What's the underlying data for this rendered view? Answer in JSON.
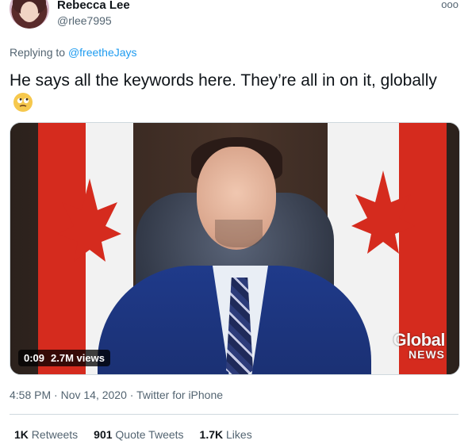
{
  "user": {
    "display_name": "Rebecca Lee",
    "handle": "@rlee7995"
  },
  "reply": {
    "prefix": "Replying to",
    "mention": "@freetheJays"
  },
  "tweet": {
    "text": "He says all the keywords here. They’re all in on it, globally",
    "emoji": "eye-roll-emoji"
  },
  "video": {
    "time": "0:09",
    "views": "2.7M views",
    "logo_line1": "Global",
    "logo_line2": "NEWS"
  },
  "meta": {
    "time": "4:58 PM",
    "date": "Nov 14, 2020",
    "source": "Twitter for iPhone"
  },
  "stats": {
    "retweets_count": "1K",
    "retweets_label": "Retweets",
    "quotes_count": "901",
    "quotes_label": "Quote Tweets",
    "likes_count": "1.7K",
    "likes_label": "Likes"
  },
  "colors": {
    "link": "#1d9bf0",
    "secondary_text": "#536471",
    "primary_text": "#0f1419",
    "flag_red": "#d52b1e"
  }
}
